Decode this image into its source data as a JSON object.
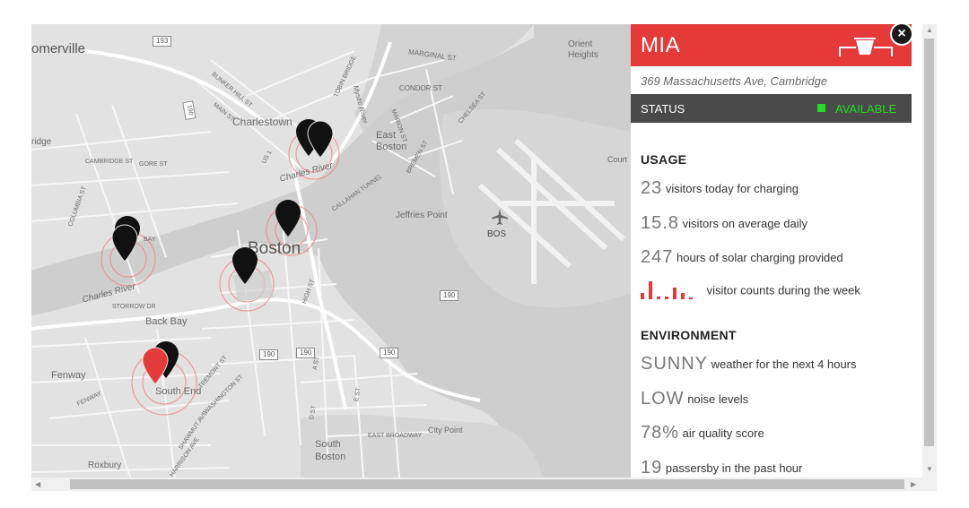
{
  "map": {
    "places": [
      "omerville",
      "Charlestown",
      "East Boston",
      "Boston",
      "Back Bay",
      "Fenway",
      "South End",
      "South Boston",
      "Roxbury",
      "Jeffries Point",
      "BOS",
      "Orient Heights",
      "Court",
      "ridge",
      "Charles River",
      "Charles River"
    ],
    "streets": [
      "MARGINAL ST",
      "CONDOR ST",
      "CAMBRIDGE ST",
      "GORE ST",
      "COLUMBIA ST",
      "BUNKER HILL ST",
      "MAIN ST",
      "TOBIN BRIDGE",
      "Mystic River",
      "CHELSEA ST",
      "MARION ST",
      "BREMEN ST",
      "CALLAHAN TUNNEL",
      "STORROW DR",
      "HIGH ST",
      "TREMONT ST",
      "WASHINGTON ST",
      "SHAWMUT AVE",
      "HARRISON AVE",
      "EAST BROADWAY",
      "City Point",
      "A ST",
      "D ST",
      "E ST",
      "FENWAY",
      "US 1",
      "BAY"
    ],
    "highways": [
      "193",
      "190",
      "190",
      "190",
      "190",
      "190"
    ]
  },
  "panel": {
    "name": "MIA",
    "address": "369 Massachusetts Ave, Cambridge",
    "status_label": "STATUS",
    "status_value": "AVAILABLE",
    "usage_title": "USAGE",
    "usage": [
      {
        "value": "23",
        "desc": "visitors today for charging"
      },
      {
        "value": "15.8",
        "desc": "visitors on average daily"
      },
      {
        "value": "247",
        "desc": "hours of solar charging provided"
      }
    ],
    "week_desc": "visitor counts during the week",
    "environment_title": "ENVIRONMENT",
    "environment": [
      {
        "value": "SUNNY",
        "desc": "weather for the next 4 hours"
      },
      {
        "value": "LOW",
        "desc": "noise levels"
      },
      {
        "value": "78%",
        "desc": "air quality score"
      },
      {
        "value": "19",
        "desc": "passersby in the past hour"
      }
    ],
    "icons": {
      "close": "close-icon",
      "station": "solar-bench-icon"
    }
  },
  "colors": {
    "accent": "#e53a3a",
    "status": "#22dd22",
    "status_bar": "#4a4a4a",
    "pin": "#111111",
    "pin_active": "#e53a3a"
  },
  "chart_data": {
    "type": "bar",
    "values": [
      2,
      6,
      1,
      1,
      4,
      2,
      0.5
    ]
  }
}
